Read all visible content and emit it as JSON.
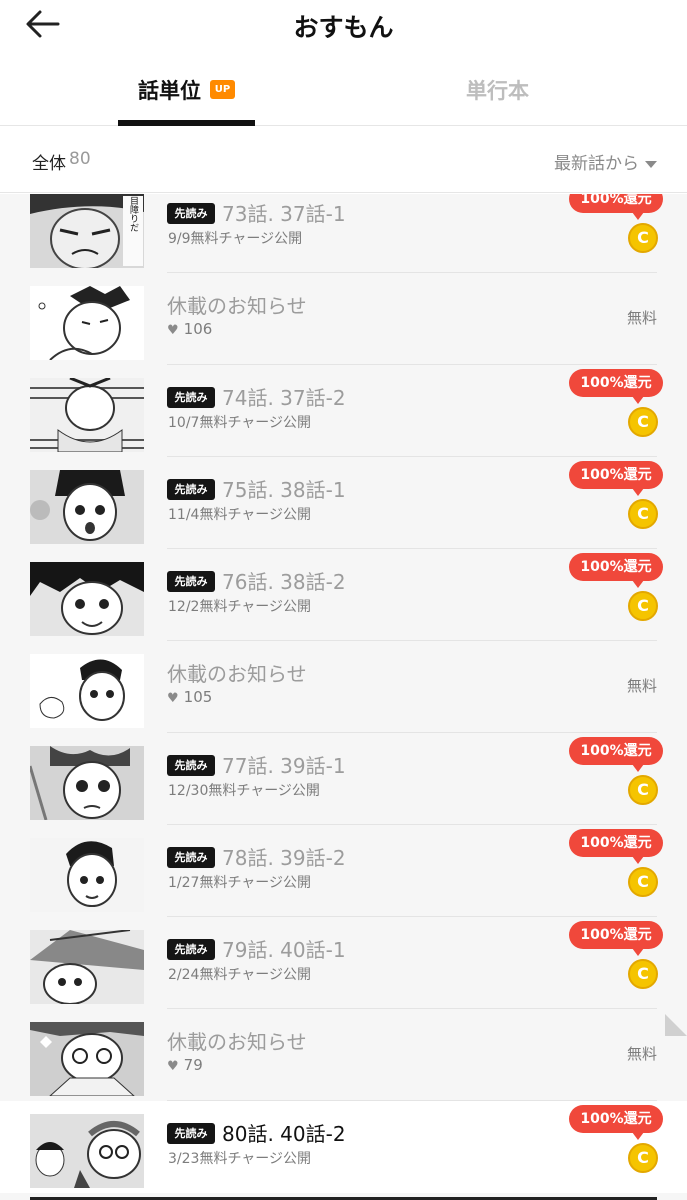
{
  "header": {
    "title": "おすもん",
    "back_icon": "arrow-left-icon"
  },
  "tabs": [
    {
      "label": "話単位",
      "badge": "UP",
      "selected": true
    },
    {
      "label": "単行本",
      "selected": false
    }
  ],
  "list_header": {
    "count_label": "全体",
    "count": "80",
    "sort_label": "最新話から"
  },
  "colors": {
    "accent": "#ff8a00",
    "refund": "#f0483b",
    "coin": "#f5c400"
  },
  "episodes": [
    {
      "type": "episode",
      "badge": "先読み",
      "title": "73話. 37話-1",
      "subtitle": "9/9無料チャージ公開",
      "refund": "100%還元",
      "coin": "C"
    },
    {
      "type": "notice",
      "title": "休載のお知らせ",
      "likes": "106",
      "price": "無料"
    },
    {
      "type": "episode",
      "badge": "先読み",
      "title": "74話. 37話-2",
      "subtitle": "10/7無料チャージ公開",
      "refund": "100%還元",
      "coin": "C"
    },
    {
      "type": "episode",
      "badge": "先読み",
      "title": "75話. 38話-1",
      "subtitle": "11/4無料チャージ公開",
      "refund": "100%還元",
      "coin": "C"
    },
    {
      "type": "episode",
      "badge": "先読み",
      "title": "76話. 38話-2",
      "subtitle": "12/2無料チャージ公開",
      "refund": "100%還元",
      "coin": "C"
    },
    {
      "type": "notice",
      "title": "休載のお知らせ",
      "likes": "105",
      "price": "無料"
    },
    {
      "type": "episode",
      "badge": "先読み",
      "title": "77話. 39話-1",
      "subtitle": "12/30無料チャージ公開",
      "refund": "100%還元",
      "coin": "C"
    },
    {
      "type": "episode",
      "badge": "先読み",
      "title": "78話. 39話-2",
      "subtitle": "1/27無料チャージ公開",
      "refund": "100%還元",
      "coin": "C"
    },
    {
      "type": "episode",
      "badge": "先読み",
      "title": "79話. 40話-1",
      "subtitle": "2/24無料チャージ公開",
      "refund": "100%還元",
      "coin": "C"
    },
    {
      "type": "notice",
      "title": "休載のお知らせ",
      "likes": "79",
      "price": "無料"
    },
    {
      "type": "episode",
      "badge": "先読み",
      "title": "80話. 40話-2",
      "subtitle": "3/23無料チャージ公開",
      "refund": "100%還元",
      "coin": "C",
      "highlighted": true
    }
  ],
  "thumb_texts": {
    "first": "目障りだ"
  }
}
